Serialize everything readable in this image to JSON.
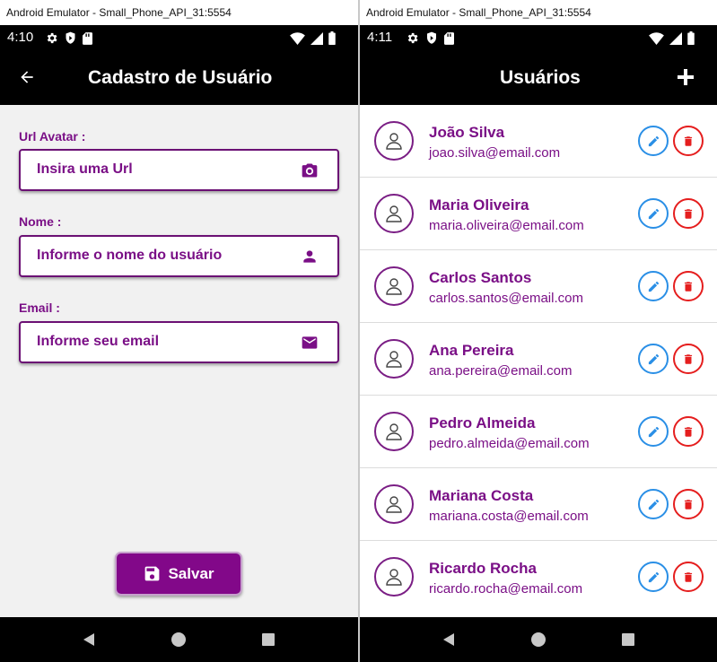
{
  "left_window": {
    "title": "Android Emulator - Small_Phone_API_31:5554",
    "status_time": "4:10",
    "app_title": "Cadastro de Usuário",
    "fields": [
      {
        "label": "Url Avatar :",
        "placeholder": "Insira uma Url",
        "icon": "camera-icon"
      },
      {
        "label": "Nome :",
        "placeholder": "Informe o nome do usuário",
        "icon": "person-icon"
      },
      {
        "label": "Email :",
        "placeholder": "Informe seu email",
        "icon": "mail-icon"
      }
    ],
    "save_label": "Salvar"
  },
  "right_window": {
    "title": "Android Emulator - Small_Phone_API_31:5554",
    "status_time": "4:11",
    "app_title": "Usuários",
    "users": [
      {
        "name": "João Silva",
        "email": "joao.silva@email.com"
      },
      {
        "name": "Maria Oliveira",
        "email": "maria.oliveira@email.com"
      },
      {
        "name": "Carlos Santos",
        "email": "carlos.santos@email.com"
      },
      {
        "name": "Ana Pereira",
        "email": "ana.pereira@email.com"
      },
      {
        "name": "Pedro Almeida",
        "email": "pedro.almeida@email.com"
      },
      {
        "name": "Mariana Costa",
        "email": "mariana.costa@email.com"
      },
      {
        "name": "Ricardo Rocha",
        "email": "ricardo.rocha@email.com"
      }
    ]
  },
  "colors": {
    "accent_purple": "#820889",
    "edit_blue": "#2a8fe6",
    "delete_red": "#e51e1e"
  }
}
